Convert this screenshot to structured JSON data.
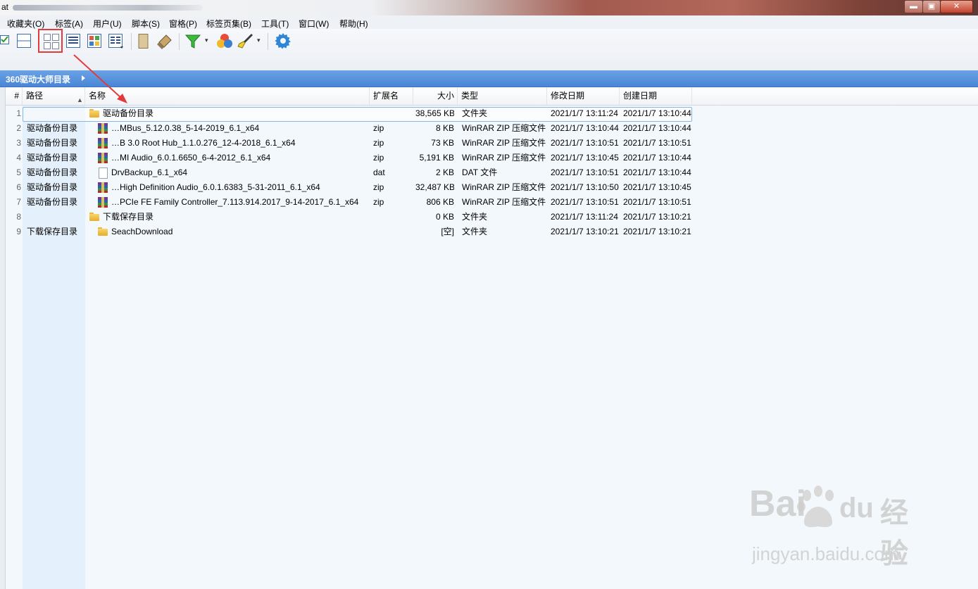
{
  "window": {
    "title_visible": "at",
    "buttons": {
      "minimize": "▬",
      "maximize": "▣",
      "close": "✕"
    }
  },
  "menubar": {
    "items": [
      "收藏夹(O)",
      "标签(A)",
      "用户(U)",
      "脚本(S)",
      "窗格(P)",
      "标签页集(B)",
      "工具(T)",
      "窗口(W)",
      "帮助(H)"
    ]
  },
  "toolbar": {
    "icons": [
      "checkbox-icon",
      "split-horizontal-icon",
      "grid-view-icon",
      "detail-view-icon",
      "color-grid-icon",
      "columns-view-icon",
      "bookmark-icon",
      "eraser-icon",
      "filter-icon",
      "color-balls-icon",
      "brush-icon",
      "gear-icon"
    ]
  },
  "breadcrumb": {
    "label": "360驱动大师目录"
  },
  "columns": {
    "num": "#",
    "path": "路径",
    "name": "名称",
    "ext": "扩展名",
    "size": "大小",
    "type": "类型",
    "modified": "修改日期",
    "created": "创建日期"
  },
  "rows": [
    {
      "num": "1",
      "path": "",
      "name": "驱动备份目录",
      "ext": "",
      "size": "38,565 KB",
      "type": "文件夹",
      "modified": "2021/1/7 13:11:24",
      "created": "2021/1/7 13:10:44",
      "icon": "folder-icon"
    },
    {
      "num": "2",
      "path": "驱动备份目录",
      "name": "…MBus_5.12.0.38_5-14-2019_6.1_x64",
      "ext": "zip",
      "size": "8 KB",
      "type": "WinRAR ZIP 压缩文件",
      "modified": "2021/1/7 13:10:44",
      "created": "2021/1/7 13:10:44",
      "icon": "winrar-icon"
    },
    {
      "num": "3",
      "path": "驱动备份目录",
      "name": "…B 3.0 Root Hub_1.1.0.276_12-4-2018_6.1_x64",
      "ext": "zip",
      "size": "73 KB",
      "type": "WinRAR ZIP 压缩文件",
      "modified": "2021/1/7 13:10:51",
      "created": "2021/1/7 13:10:51",
      "icon": "winrar-icon"
    },
    {
      "num": "4",
      "path": "驱动备份目录",
      "name": "…MI Audio_6.0.1.6650_6-4-2012_6.1_x64",
      "ext": "zip",
      "size": "5,191 KB",
      "type": "WinRAR ZIP 压缩文件",
      "modified": "2021/1/7 13:10:45",
      "created": "2021/1/7 13:10:44",
      "icon": "winrar-icon"
    },
    {
      "num": "5",
      "path": "驱动备份目录",
      "name": "DrvBackup_6.1_x64",
      "ext": "dat",
      "size": "2 KB",
      "type": "DAT 文件",
      "modified": "2021/1/7 13:10:51",
      "created": "2021/1/7 13:10:44",
      "icon": "file-icon"
    },
    {
      "num": "6",
      "path": "驱动备份目录",
      "name": "…High Definition Audio_6.0.1.6383_5-31-2011_6.1_x64",
      "ext": "zip",
      "size": "32,487 KB",
      "type": "WinRAR ZIP 压缩文件",
      "modified": "2021/1/7 13:10:50",
      "created": "2021/1/7 13:10:45",
      "icon": "winrar-icon"
    },
    {
      "num": "7",
      "path": "驱动备份目录",
      "name": "…PCIe FE Family Controller_7.113.914.2017_9-14-2017_6.1_x64",
      "ext": "zip",
      "size": "806 KB",
      "type": "WinRAR ZIP 压缩文件",
      "modified": "2021/1/7 13:10:51",
      "created": "2021/1/7 13:10:51",
      "icon": "winrar-icon"
    },
    {
      "num": "8",
      "path": "",
      "name": "下载保存目录",
      "ext": "",
      "size": "0 KB",
      "type": "文件夹",
      "modified": "2021/1/7 13:11:24",
      "created": "2021/1/7 13:10:21",
      "icon": "folder-icon"
    },
    {
      "num": "9",
      "path": "下载保存目录",
      "name": "SeachDownload",
      "ext": "",
      "size": "[空]",
      "type": "文件夹",
      "modified": "2021/1/7 13:10:21",
      "created": "2021/1/7 13:10:21",
      "icon": "folder-icon"
    }
  ],
  "watermark": {
    "brand": "Bai",
    "brand2": "du",
    "cn": "经验",
    "url": "jingyan.baidu.com"
  },
  "colors": {
    "accent": "#4a86d6",
    "highlight": "#e23b3b",
    "selection_border": "#86b6e9"
  }
}
